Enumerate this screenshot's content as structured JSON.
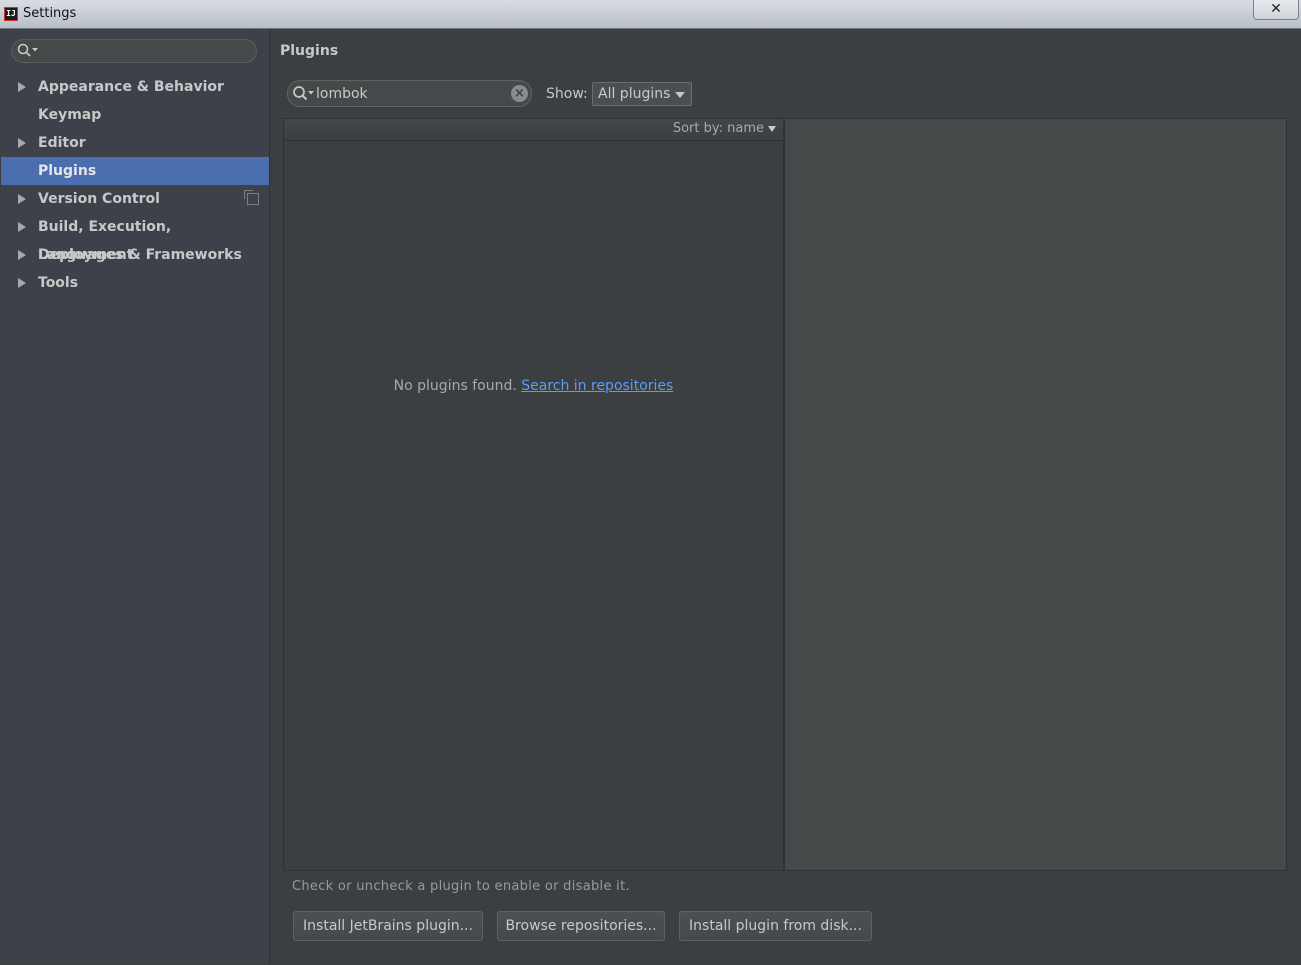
{
  "window": {
    "title": "Settings",
    "close_label": "✕"
  },
  "sidebar": {
    "search_placeholder": "",
    "items": [
      {
        "label": "Appearance & Behavior",
        "expandable": true,
        "selected": false
      },
      {
        "label": "Keymap",
        "expandable": false,
        "selected": false
      },
      {
        "label": "Editor",
        "expandable": true,
        "selected": false
      },
      {
        "label": "Plugins",
        "expandable": false,
        "selected": true
      },
      {
        "label": "Version Control",
        "expandable": true,
        "selected": false
      },
      {
        "label": "Build, Execution, Deployment",
        "expandable": true,
        "selected": false
      },
      {
        "label": "Languages & Frameworks",
        "expandable": true,
        "selected": false
      },
      {
        "label": "Tools",
        "expandable": true,
        "selected": false
      }
    ]
  },
  "main": {
    "title": "Plugins",
    "search": {
      "value": "lombok"
    },
    "show": {
      "label": "Show:",
      "selected": "All plugins"
    },
    "list": {
      "sort_label": "Sort by: name",
      "empty_text": "No plugins found. ",
      "empty_link": "Search in repositories"
    },
    "hint": "Check or uncheck a plugin to enable or disable it.",
    "buttons": {
      "install_jetbrains": "Install JetBrains plugin...",
      "browse": "Browse repositories...",
      "install_disk": "Install plugin from disk..."
    }
  },
  "colors": {
    "sidebar_bg": "#3d424a",
    "selection": "#4b6eaf",
    "link": "#589df6",
    "panel_bg": "#3c3f41"
  },
  "icons": [
    "app-icon",
    "close-icon",
    "search-icon",
    "clear-icon",
    "chevron-down-icon",
    "expand-arrow-icon",
    "copy-icon"
  ]
}
